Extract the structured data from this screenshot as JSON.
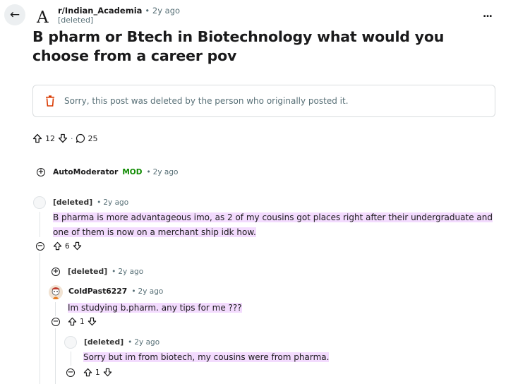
{
  "post": {
    "subreddit": "r/Indian_Academia",
    "time": "2y ago",
    "author": "[deleted]",
    "title": "B pharm or Btech in Biotechnology what would you choose from a career pov",
    "more_label": "...",
    "subreddit_icon_letter": "A",
    "deleted_notice": "Sorry, this post was deleted by the person who originally posted it.",
    "votes": "12",
    "comments": "25",
    "separator": "·"
  },
  "comments": [
    {
      "author": "AutoModerator",
      "badge": "MOD",
      "time": "2y ago",
      "collapsed": true
    },
    {
      "author": "[deleted]",
      "time": "2y ago",
      "body": "B pharma is more advantageous imo, as 2 of my cousins got places right after their undergraduate and one of them is now on a merchant ship idk how.",
      "votes": "6"
    },
    {
      "author": "[deleted]",
      "time": "2y ago",
      "collapsed": true
    },
    {
      "author": "ColdPast6227",
      "time": "2y ago",
      "body": "Im studying b.pharm. any tips for me ???",
      "votes": "1"
    },
    {
      "author": "[deleted]",
      "time": "2y ago",
      "body": "Sorry but im from biotech, my cousins were from pharma.",
      "votes": "1"
    }
  ],
  "bullet": "•",
  "icons": {
    "back": "arrow-left-icon",
    "trash": "trash-icon",
    "upvote": "upvote-icon",
    "downvote": "downvote-icon",
    "comment": "comment-icon",
    "expand": "plus-circle-icon",
    "collapse": "minus-circle-icon"
  },
  "colors": {
    "highlight": "#f3dbfe",
    "mod": "#0e8a00",
    "trash": "#d93900",
    "muted": "#576f76"
  }
}
